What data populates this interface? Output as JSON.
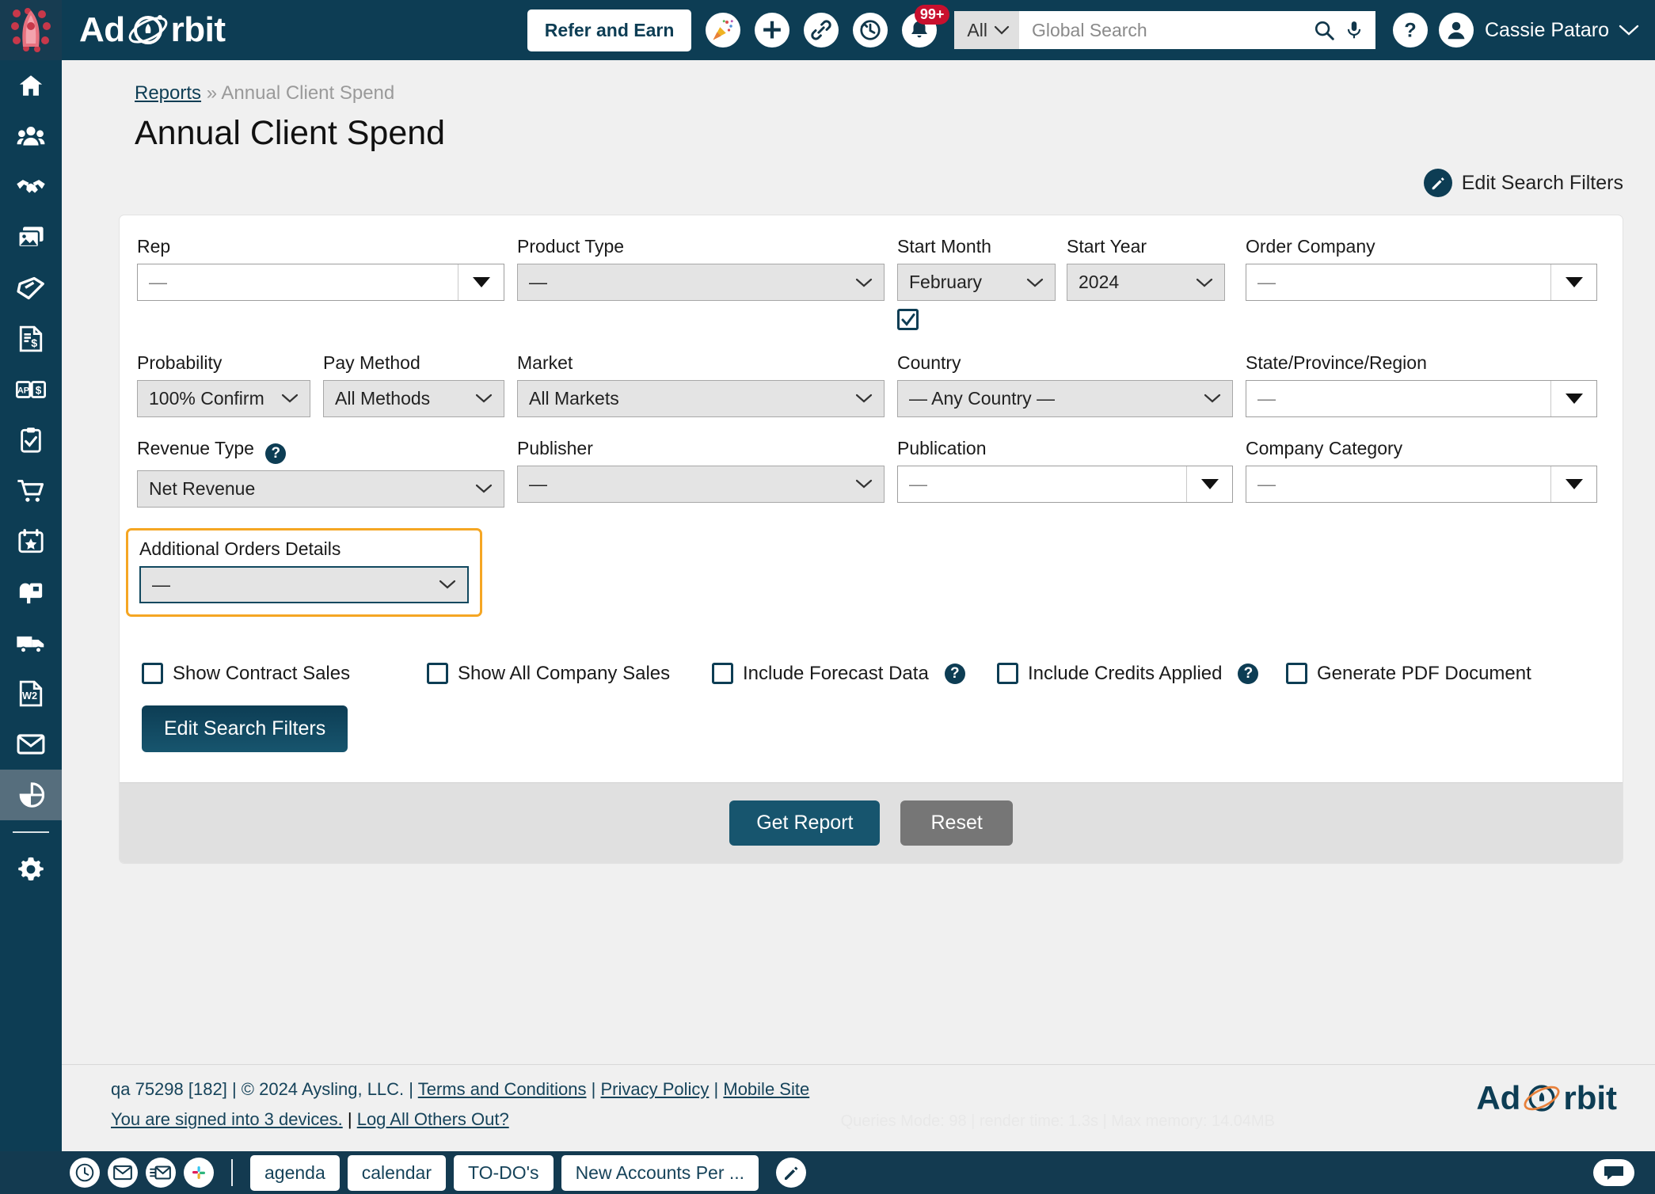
{
  "topbar": {
    "brand": "Ad Orbit",
    "refer_label": "Refer and Earn",
    "icons": [
      "celebration-icon",
      "add-icon",
      "link-icon",
      "history-icon",
      "notifications-icon"
    ],
    "notification_badge": "99+",
    "search_scope": "All",
    "search_placeholder": "Global Search",
    "search_value": "",
    "user_name": "Cassie Pataro"
  },
  "sidebar": {
    "items": [
      {
        "name": "home",
        "active": false
      },
      {
        "name": "contacts",
        "active": false
      },
      {
        "name": "deals",
        "active": false
      },
      {
        "name": "media",
        "active": false
      },
      {
        "name": "tickets",
        "active": false
      },
      {
        "name": "invoices",
        "active": false
      },
      {
        "name": "accounts-payable",
        "active": false
      },
      {
        "name": "tasks",
        "active": false
      },
      {
        "name": "orders",
        "active": false
      },
      {
        "name": "events",
        "active": false
      },
      {
        "name": "mailbox",
        "active": false
      },
      {
        "name": "distribution",
        "active": false
      },
      {
        "name": "w2-documents",
        "active": false
      },
      {
        "name": "email",
        "active": false
      },
      {
        "name": "reports",
        "active": true
      },
      {
        "name": "settings",
        "active": false
      }
    ]
  },
  "page": {
    "breadcrumb_root": "Reports",
    "breadcrumb_sep": "»",
    "breadcrumb_current": "Annual Client Spend",
    "title": "Annual Client Spend",
    "edit_filters_top": "Edit Search Filters"
  },
  "filters": {
    "rep": {
      "label": "Rep",
      "value": "—"
    },
    "product_type": {
      "label": "Product Type",
      "value": "—"
    },
    "start_month": {
      "label": "Start Month",
      "value": "February",
      "checkbox_checked": true
    },
    "start_year": {
      "label": "Start Year",
      "value": "2024"
    },
    "order_company": {
      "label": "Order Company",
      "value": "—"
    },
    "probability": {
      "label": "Probability",
      "value": "100% Confirm"
    },
    "pay_method": {
      "label": "Pay Method",
      "value": "All Methods"
    },
    "market": {
      "label": "Market",
      "value": "All Markets"
    },
    "country": {
      "label": "Country",
      "value": "— Any Country —"
    },
    "state_province_region": {
      "label": "State/Province/Region",
      "value": "—"
    },
    "revenue_type": {
      "label": "Revenue Type",
      "value": "Net Revenue",
      "help": "?"
    },
    "publisher": {
      "label": "Publisher",
      "value": "—"
    },
    "publication": {
      "label": "Publication",
      "value": "—"
    },
    "company_category": {
      "label": "Company Category",
      "value": "—"
    },
    "additional_orders_details": {
      "label": "Additional Orders Details",
      "value": "—",
      "highlighted": true
    }
  },
  "checkboxes": [
    {
      "label": "Show Contract Sales",
      "checked": false,
      "help": false
    },
    {
      "label": "Show All Company Sales",
      "checked": false,
      "help": false
    },
    {
      "label": "Include Forecast Data",
      "checked": false,
      "help": true
    },
    {
      "label": "Include Credits Applied",
      "checked": false,
      "help": true
    },
    {
      "label": "Generate PDF Document",
      "checked": false,
      "help": false
    }
  ],
  "actions": {
    "edit_search_filters": "Edit Search Filters",
    "get_report": "Get Report",
    "reset": "Reset"
  },
  "footer": {
    "build": "qa 75298 [182]",
    "sep": "|",
    "copyright": "© 2024 Aysling, LLC.",
    "terms": "Terms and Conditions",
    "privacy": "Privacy Policy",
    "mobile": "Mobile Site",
    "devices": "You are signed into 3 devices.",
    "logout_others": "Log All Others Out?",
    "queries": "Queries Mode: 98 | render time: 1.3s | Max memory: 14.04MB",
    "logo": "Ad Orbit"
  },
  "taskbar": {
    "icons": [
      "clock-icon",
      "envelope-icon",
      "inbox-icon",
      "slack-icon"
    ],
    "chips": [
      "agenda",
      "calendar",
      "TO-DO's",
      "New Accounts Per ..."
    ],
    "edit_icon": "pencil-icon",
    "chat_icon": "chat-icon"
  },
  "colors": {
    "navy": "#0d3d54",
    "accent_orange": "#f5a623",
    "badge_red": "#c8102e",
    "sidebar_active": "#566e7d"
  }
}
